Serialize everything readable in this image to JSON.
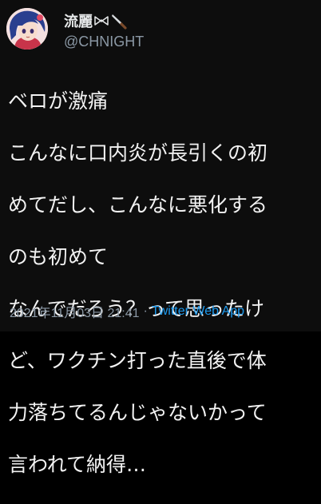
{
  "user": {
    "display_name": "流麗",
    "handle": "@CHNIGHT",
    "name_icons": [
      "bowtie-icon",
      "knife-icon"
    ],
    "avatar": "avatar-anime-character"
  },
  "tweet": {
    "lines": [
      "ベロが激痛",
      "こんなに口内炎が長引くの初",
      "めてだし、こんなに悪化する",
      "のも初めて",
      "なんでだろう？って思ったけ",
      "ど、ワクチン打った直後で体",
      "力落ちてるんじゃないかって",
      "言われて納得…"
    ]
  },
  "meta": {
    "timestamp": "2021年11月03日 21:41",
    "separator": "·",
    "source": "Twitter Web App"
  },
  "colors": {
    "background": "#0d0d0d",
    "text": "#f2f2f2",
    "secondary": "#8b98a5",
    "link": "#1d9bf0"
  }
}
